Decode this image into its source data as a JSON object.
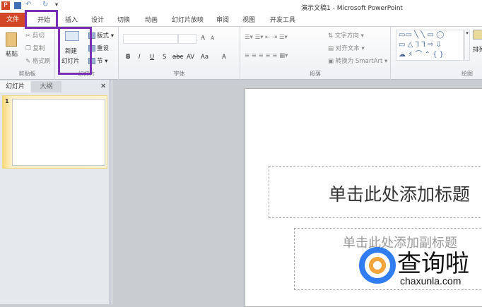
{
  "window": {
    "title": "演示文稿1 - Microsoft PowerPoint"
  },
  "tabs": [
    "文件",
    "开始",
    "插入",
    "设计",
    "切换",
    "动画",
    "幻灯片放映",
    "审阅",
    "视图",
    "开发工具"
  ],
  "ribbon": {
    "clipboard": {
      "label": "剪贴板",
      "paste": "粘贴",
      "cut": "剪切",
      "copy": "复制",
      "format_painter": "格式刷"
    },
    "slides": {
      "label": "幻灯片",
      "new_slide_1": "新建",
      "new_slide_2": "幻灯片",
      "layout": "版式",
      "reset": "重设",
      "section": "节"
    },
    "font": {
      "label": "字体",
      "bold": "B",
      "italic": "I",
      "underline": "U",
      "shadow": "S",
      "strike": "abc",
      "spacing": "AV",
      "case": "Aa",
      "color": "A",
      "grow": "A",
      "shrink": "A"
    },
    "paragraph": {
      "label": "段落",
      "text_direction": "文字方向",
      "align_text": "对齐文本",
      "smartart": "转换为 SmartArt"
    },
    "drawing": {
      "label": "绘图",
      "arrange": "排列"
    }
  },
  "panel": {
    "tab_slides": "幻灯片",
    "tab_outline": "大纲",
    "close": "✕",
    "slide_number": "1"
  },
  "slide": {
    "title_placeholder": "单击此处添加标题",
    "subtitle_placeholder": "单击此处添加副标题"
  },
  "watermark": {
    "brand": "查询啦",
    "domain": "chaxunla.com"
  },
  "colors": {
    "file_tab": "#d24726",
    "highlight": "#7a2fb3"
  }
}
